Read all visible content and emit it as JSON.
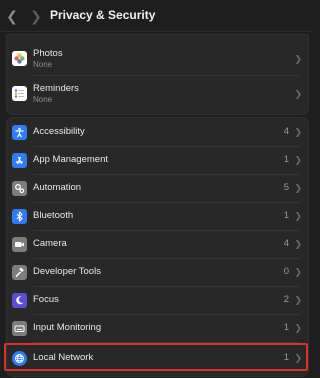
{
  "toolbar": {
    "back_icon": "chevron-left-icon",
    "forward_icon": "chevron-right-icon",
    "title": "Privacy & Security"
  },
  "top_group": [
    {
      "label": "Photos",
      "sublabel": "None",
      "icon": "photos-icon"
    },
    {
      "label": "Reminders",
      "sublabel": "None",
      "icon": "reminders-icon"
    }
  ],
  "settings_group": [
    {
      "label": "Accessibility",
      "count": "4",
      "icon": "accessibility-icon",
      "color": "#2f7cf6"
    },
    {
      "label": "App Management",
      "count": "1",
      "icon": "app-store-icon",
      "color": "#2f7cf6"
    },
    {
      "label": "Automation",
      "count": "5",
      "icon": "gears-icon",
      "color": "#7d7d7d"
    },
    {
      "label": "Bluetooth",
      "count": "1",
      "icon": "bluetooth-icon",
      "color": "#2f7cf6"
    },
    {
      "label": "Camera",
      "count": "4",
      "icon": "camera-icon",
      "color": "#7d7d7d"
    },
    {
      "label": "Developer Tools",
      "count": "0",
      "icon": "hammer-icon",
      "color": "#7d7d7d"
    },
    {
      "label": "Focus",
      "count": "2",
      "icon": "moon-icon",
      "color": "#5b4fd6"
    },
    {
      "label": "Input Monitoring",
      "count": "1",
      "icon": "keyboard-icon",
      "color": "#7d7d7d"
    },
    {
      "label": "Local Network",
      "count": "1",
      "icon": "globe-icon",
      "color": "#2f7cf6"
    }
  ],
  "colors": {
    "highlight": "#d9302a",
    "window_bg": "#1e1e1e",
    "group_bg": "#282828"
  }
}
